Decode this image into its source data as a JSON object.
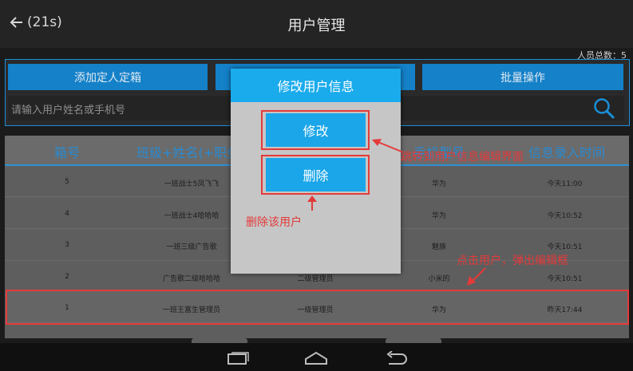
{
  "header": {
    "back_label": "(21s)",
    "title": "用户管理"
  },
  "summary": {
    "total_label": "人员总数：5"
  },
  "toolbar": {
    "add_label": "添加定人定箱",
    "mid_label": "",
    "batch_label": "批量操作"
  },
  "search": {
    "placeholder": "请输入用户姓名或手机号"
  },
  "table": {
    "columns": [
      "箱号",
      "班级+姓名(+职务",
      "",
      "手机型号",
      "信息录入时间"
    ],
    "rows": [
      {
        "box": "5",
        "name": "一班战士5凤飞飞",
        "role": "",
        "phone": "华为",
        "time": "今天11:00"
      },
      {
        "box": "4",
        "name": "一班战士4哈哈哈",
        "role": "",
        "phone": "华为",
        "time": "今天10:52"
      },
      {
        "box": "3",
        "name": "一班三级广告歌",
        "role": "",
        "phone": "魅族",
        "time": "今天10:51"
      },
      {
        "box": "2",
        "name": "广告歌二级哈哈哈",
        "role": "二级管理员",
        "phone": "小米的",
        "time": "今天10:51"
      },
      {
        "box": "1",
        "name": "一班王富生管理员",
        "role": "一级管理员",
        "phone": "华为",
        "time": "昨天17:44"
      }
    ]
  },
  "dialog": {
    "title": "修改用户信息",
    "edit_label": "修改",
    "delete_label": "删除"
  },
  "annotations": {
    "edit_note": "跳转到用户信息编辑界面",
    "delete_note": "删除该用户",
    "click_note": "点击用户，弹出编辑框"
  },
  "colors": {
    "accent": "#1aabec",
    "highlight": "#e43a3a",
    "header_text": "#2b8ad0"
  }
}
